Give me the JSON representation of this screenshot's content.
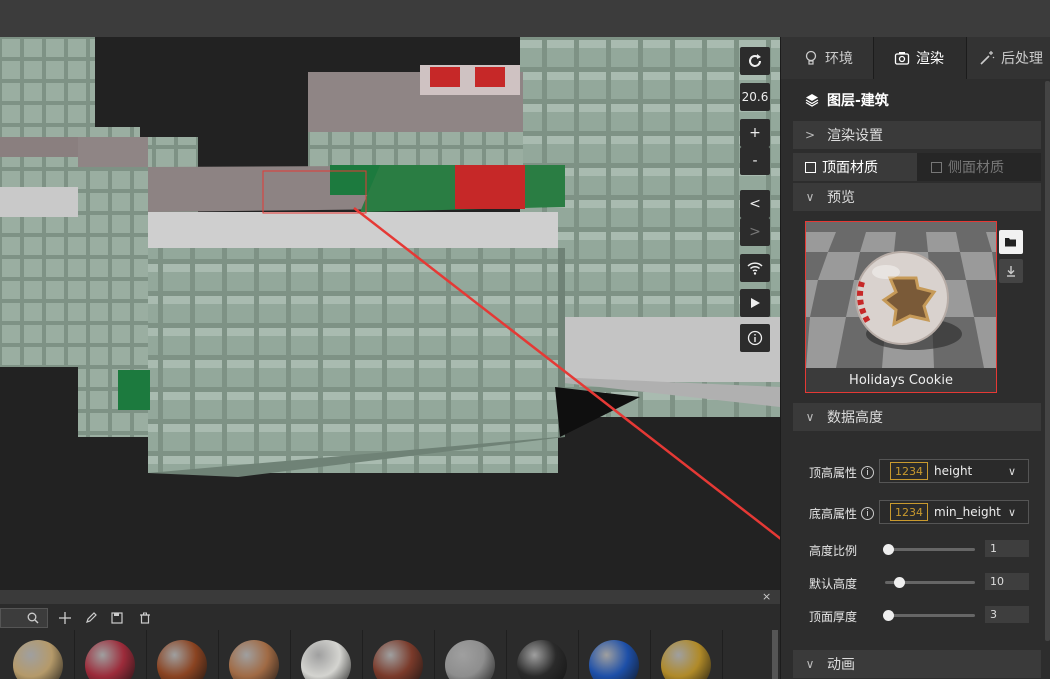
{
  "viewport": {
    "rotate_icon": "rotate-icon",
    "zoom_value": "20.6",
    "zoom_in": "+",
    "zoom_out": "-",
    "prev": "<",
    "next": ">",
    "wifi_icon": "wifi-icon",
    "play_icon": "play-icon",
    "info_icon": "info-icon"
  },
  "tabs": [
    {
      "label": "环境",
      "icon": "bulb-icon"
    },
    {
      "label": "渲染",
      "icon": "camera-icon"
    },
    {
      "label": "后处理",
      "icon": "wand-icon"
    }
  ],
  "layer_title": "图层-建筑",
  "sections": {
    "render_settings": "渲染设置",
    "preview": "预览",
    "data_height": "数据高度",
    "animation": "动画"
  },
  "material_tabs": {
    "top": "顶面材质",
    "side": "侧面材质"
  },
  "preview": {
    "material_name": "Holidays Cookie"
  },
  "fields": {
    "top_height": {
      "label": "顶高属性",
      "tag": "1234",
      "value": "height"
    },
    "base_height": {
      "label": "底高属性",
      "tag": "1234",
      "value": "min_height"
    }
  },
  "sliders": {
    "height_scale": {
      "label": "高度比例",
      "value": "1",
      "fraction": 0.0
    },
    "default_height": {
      "label": "默认高度",
      "value": "10",
      "fraction": 0.12
    },
    "top_thickness": {
      "label": "顶面厚度",
      "value": "3",
      "fraction": 0.0
    }
  },
  "bottom_panel": {
    "close": "×",
    "tools": [
      "search-icon",
      "add-icon",
      "edit-icon",
      "save-icon",
      "delete-icon"
    ]
  },
  "materials": [
    {
      "name": "sand",
      "color": "#b59a6a"
    },
    {
      "name": "red-fabric",
      "color": "#9c2b3a"
    },
    {
      "name": "wood",
      "color": "#8a4321"
    },
    {
      "name": "copper",
      "color": "#a06a44"
    },
    {
      "name": "white-rough",
      "color": "#d4d4d0"
    },
    {
      "name": "rust",
      "color": "#7a3a2a"
    },
    {
      "name": "grey-metal",
      "color": "#8e8e8e"
    },
    {
      "name": "black",
      "color": "#2a2a2a"
    },
    {
      "name": "blue",
      "color": "#1d4fa8"
    },
    {
      "name": "gold",
      "color": "#b08a28"
    }
  ],
  "colors": {
    "accent_red": "#e53935",
    "tag_gold": "#c99a2e"
  }
}
